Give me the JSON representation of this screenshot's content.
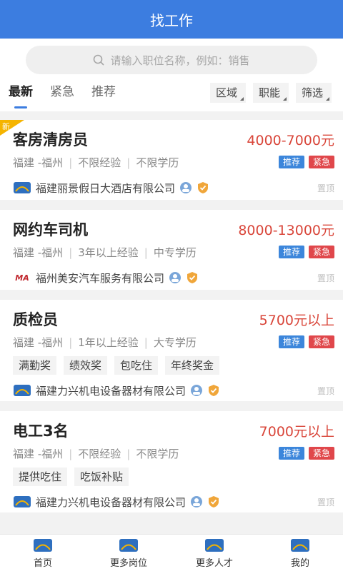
{
  "header": {
    "title": "找工作"
  },
  "search": {
    "placeholder": "请输入职位名称，例如：销售"
  },
  "tabs": [
    {
      "label": "最新"
    },
    {
      "label": "紧急"
    },
    {
      "label": "推荐"
    }
  ],
  "filters": [
    {
      "label": "区域"
    },
    {
      "label": "职能"
    },
    {
      "label": "筛选"
    }
  ],
  "jobs": [
    {
      "new_label": "新",
      "title": "客房清房员",
      "salary": "4000-7000元",
      "location": "福建 -福州",
      "experience": "不限经验",
      "education": "不限学历",
      "badge_recommend": "推荐",
      "badge_urgent": "紧急",
      "perks": [],
      "company": "福建丽景假日大酒店有限公司",
      "pin": "置顶"
    },
    {
      "title": "网约车司机",
      "salary": "8000-13000元",
      "location": "福建 -福州",
      "experience": "3年以上经验",
      "education": "中专学历",
      "badge_recommend": "推荐",
      "badge_urgent": "紧急",
      "perks": [],
      "company": "福州美安汽车服务有限公司",
      "logo_text": "MA",
      "pin": "置顶"
    },
    {
      "title": "质检员",
      "salary": "5700元以上",
      "location": "福建 -福州",
      "experience": "1年以上经验",
      "education": "大专学历",
      "badge_recommend": "推荐",
      "badge_urgent": "紧急",
      "perks": [
        "满勤奖",
        "绩效奖",
        "包吃住",
        "年终奖金"
      ],
      "company": "福建力兴机电设备器材有限公司",
      "pin": "置顶"
    },
    {
      "title": "电工3名",
      "salary": "7000元以上",
      "location": "福建 -福州",
      "experience": "不限经验",
      "education": "不限学历",
      "badge_recommend": "推荐",
      "badge_urgent": "紧急",
      "perks": [
        "提供吃住",
        "吃饭补贴"
      ],
      "company": "福建力兴机电设备器材有限公司",
      "pin": "置顶"
    }
  ],
  "bottom_nav": [
    {
      "label": "首页",
      "icon": "home-icon"
    },
    {
      "label": "更多岗位",
      "icon": "jobs-icon"
    },
    {
      "label": "更多人才",
      "icon": "talent-icon"
    },
    {
      "label": "我的",
      "icon": "profile-icon"
    }
  ],
  "colors": {
    "primary": "#3c7de0",
    "salary": "#d9463a",
    "badge_blue": "#3c86db",
    "badge_red": "#e0474b"
  }
}
